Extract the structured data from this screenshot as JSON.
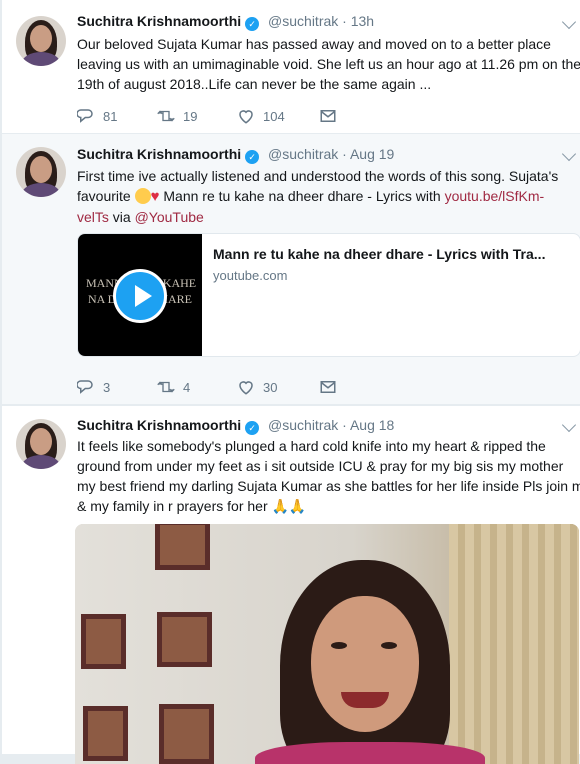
{
  "tweets": [
    {
      "name": "Suchitra Krishnamoorthi",
      "handle": "@suchitrak",
      "sep": "·",
      "time": "13h",
      "lines": [
        "Our beloved Sujata Kumar has passed away and moved on to a better place",
        "leaving us with an umimaginable void. She left us an hour ago at 11.26 pm on the",
        "19th of august 2018..Life can never be the same again ..."
      ],
      "replies": "81",
      "retweets": "19",
      "likes": "104"
    },
    {
      "name": "Suchitra Krishnamoorthi",
      "handle": "@suchitrak",
      "sep": "·",
      "time": "Aug 19",
      "line1": "First time ive actually listened and understood the words of this song. Sujata's",
      "line2_pre": "favourite",
      "line2_post": "Mann re tu kahe na dheer dhare  - Lyrics with",
      "link1": "youtu.be/lSfKm-",
      "link2": "velTs",
      "via": "via",
      "mention": "@YouTube",
      "card": {
        "title": "Mann re tu kahe na dheer dhare - Lyrics with Tra...",
        "domain": "youtube.com",
        "thumb_line1": "MANN RE TU KAHE",
        "thumb_line2": "NA DHEER DHARE"
      },
      "replies": "3",
      "retweets": "4",
      "likes": "30"
    },
    {
      "name": "Suchitra Krishnamoorthi",
      "handle": "@suchitrak",
      "sep": "·",
      "time": "Aug 18",
      "lines": [
        "It feels like somebody's plunged a hard cold knife into my heart & ripped the",
        "ground from under my feet as i sit outside ICU & pray for my big sis my mother",
        "my best friend my darling Sujata Kumar as she battles for her life inside Pls join me"
      ],
      "line4": "& my family in r prayers for her"
    }
  ],
  "icons": {
    "reply": "reply-icon",
    "retweet": "retweet-icon",
    "like": "heart-icon",
    "dm": "envelope-icon",
    "verified": "verified-badge-icon",
    "caret": "chevron-down-icon"
  },
  "colors": {
    "link": "#a02a43",
    "verified": "#1da1f2",
    "muted": "#657786"
  }
}
